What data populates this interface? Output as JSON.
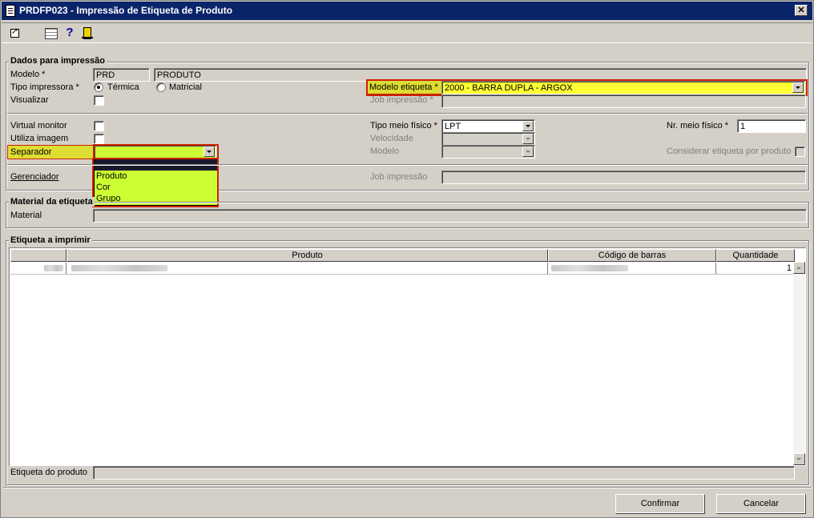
{
  "window": {
    "title": "PRDFP023 - Impressão de Etiqueta de Produto",
    "close_label": "✕"
  },
  "toolbar": {
    "help_label": "?"
  },
  "dados": {
    "group_title": "Dados para impressão",
    "modelo_label": "Modelo *",
    "modelo_code": "PRD",
    "modelo_desc": "PRODUTO",
    "tipo_impressora_label": "Tipo impressora *",
    "radio_termica": "Térmica",
    "radio_matricial": "Matricial",
    "visualizar_label": "Visualizar",
    "modelo_etiqueta_label": "Modelo etiqueta *",
    "modelo_etiqueta_value": "2000 - BARRA DUPLA - ARGOX",
    "job_impressao_label": "Job impressão *",
    "virtual_monitor_label": "Virtual monitor",
    "utiliza_imagem_label": "Utiliza imagem",
    "separador_label": "Separador",
    "separador_options": [
      "",
      "Produto",
      "Cor",
      "Grupo"
    ],
    "tipo_meio_fisico_label": "Tipo meio físico *",
    "tipo_meio_fisico_value": "LPT",
    "velocidade_label": "Velocidade",
    "modelo2_label": "Modelo",
    "nr_meio_fisico_label": "Nr. meio físico *",
    "nr_meio_fisico_value": "1",
    "considerar_label": "Considerar etiqueta por produto",
    "gerenciador_label": "Gerenciador",
    "job_impressao2_label": "Job impressão"
  },
  "material": {
    "group_title": "Material da etiqueta",
    "material_label": "Material"
  },
  "etiqueta": {
    "group_title": "Etiqueta a imprimir",
    "columns": [
      "Produto",
      "Código de barras",
      "Quantidade"
    ],
    "rows": [
      {
        "quantidade": "1"
      }
    ],
    "etiqueta_produto_label": "Etiqueta do produto"
  },
  "footer": {
    "confirmar_label": "Confirmar",
    "cancelar_label": "Cancelar"
  },
  "colors": {
    "highlight_yellow": "#ffff33",
    "highlight_lime": "#ccff33",
    "frame_red": "#cc2200",
    "title_blue": "#0a246a"
  }
}
